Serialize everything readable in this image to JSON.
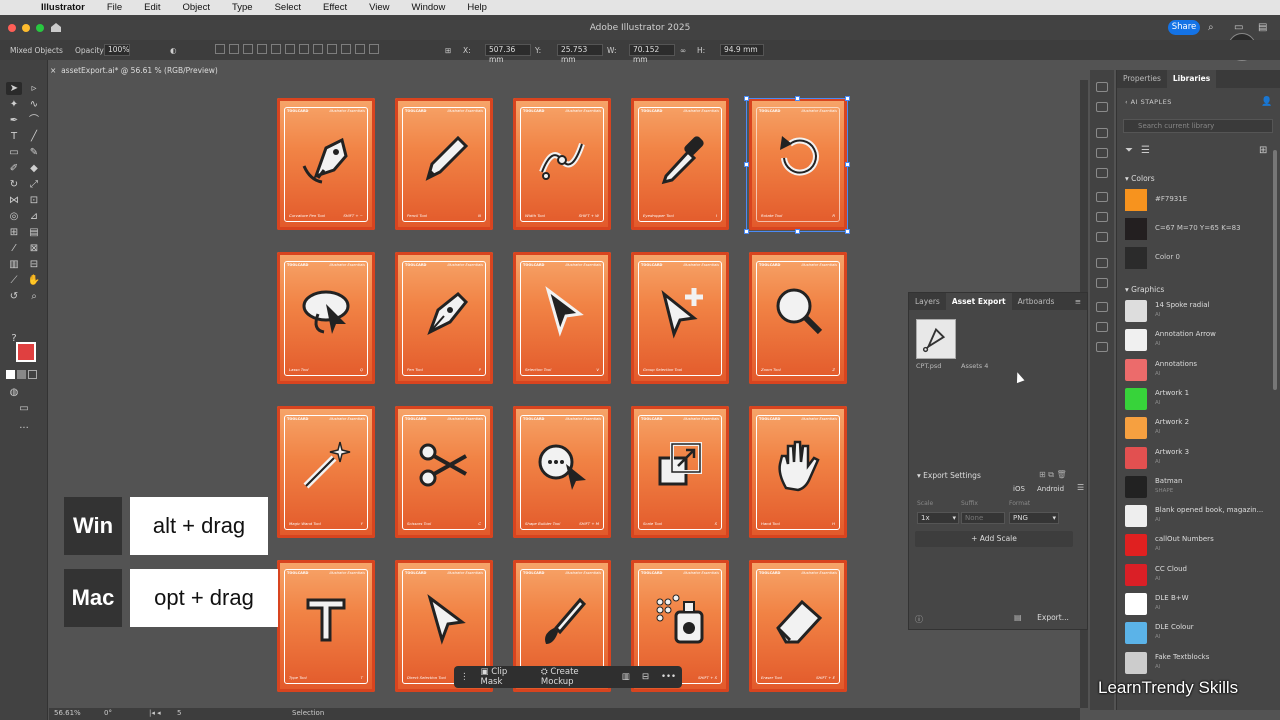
{
  "menubar": {
    "app": "Illustrator",
    "items": [
      "File",
      "Edit",
      "Object",
      "Type",
      "Select",
      "Effect",
      "View",
      "Window",
      "Help"
    ]
  },
  "titlebar": {
    "title": "Adobe Illustrator 2025",
    "share": "Share",
    "logo": "TS"
  },
  "controlbar": {
    "selection": "Mixed Objects",
    "opacity_label": "Opacity:",
    "opacity": "100%",
    "x_label": "X:",
    "x": "507.36 mm",
    "y_label": "Y:",
    "y": "25.753 mm",
    "w_label": "W:",
    "w": "70.152 mm",
    "h_label": "H:",
    "h": "94.9 mm"
  },
  "document_tab": "assetExport.ai* @ 56.61 % (RGB/Preview)",
  "cards": [
    {
      "name": "Curvature Pen Tool",
      "shortcut": "SHIFT + ~",
      "icon": "curvature-pen"
    },
    {
      "name": "Pencil Tool",
      "shortcut": "N",
      "icon": "pencil"
    },
    {
      "name": "Width Tool",
      "shortcut": "SHIFT + W",
      "icon": "width"
    },
    {
      "name": "Eyedropper Tool",
      "shortcut": "I",
      "icon": "eyedropper"
    },
    {
      "name": "Rotate Tool",
      "shortcut": "R",
      "icon": "rotate"
    },
    {
      "name": "Lasso Tool",
      "shortcut": "Q",
      "icon": "lasso"
    },
    {
      "name": "Pen Tool",
      "shortcut": "P",
      "icon": "pen"
    },
    {
      "name": "Selection Tool",
      "shortcut": "V",
      "icon": "selection"
    },
    {
      "name": "Group Selection Tool",
      "shortcut": "",
      "icon": "group-selection"
    },
    {
      "name": "Zoom Tool",
      "shortcut": "Z",
      "icon": "zoom"
    },
    {
      "name": "Magic Wand Tool",
      "shortcut": "Y",
      "icon": "magic-wand"
    },
    {
      "name": "Scissors Tool",
      "shortcut": "C",
      "icon": "scissors"
    },
    {
      "name": "Shape Builder Tool",
      "shortcut": "SHIFT + M",
      "icon": "shape-builder"
    },
    {
      "name": "Scale Tool",
      "shortcut": "S",
      "icon": "scale"
    },
    {
      "name": "Hand Tool",
      "shortcut": "H",
      "icon": "hand"
    },
    {
      "name": "Type Tool",
      "shortcut": "T",
      "icon": "type"
    },
    {
      "name": "Direct Selection Tool",
      "shortcut": "A",
      "icon": "direct-selection"
    },
    {
      "name": "Paintbrush Tool",
      "shortcut": "B",
      "icon": "paintbrush"
    },
    {
      "name": "Symbol Sprayer Tool",
      "shortcut": "SHIFT + S",
      "icon": "symbol-sprayer"
    },
    {
      "name": "Eraser Tool",
      "shortcut": "SHIFT + E",
      "icon": "eraser"
    }
  ],
  "card_header": {
    "left": "TOOLCARD",
    "right": "Illustrator Essentials"
  },
  "shortcut_overlay": {
    "win_os": "Win",
    "win_keys": "alt + drag",
    "mac_os": "Mac",
    "mac_keys": "opt + drag"
  },
  "context_bar": {
    "clip_mask": "Clip Mask",
    "create_mockup": "Create Mockup"
  },
  "statusbar": {
    "zoom": "56.61%",
    "rotation": "0°",
    "artboard": "5",
    "tool": "Selection"
  },
  "asset_export": {
    "tabs": [
      "Layers",
      "Asset Export",
      "Artboards"
    ],
    "active_tab": "Asset Export",
    "assets": [
      {
        "label": "CPT.psd"
      },
      {
        "label": "Assets 4"
      }
    ],
    "settings_title": "Export Settings",
    "platforms": [
      "iOS",
      "Android"
    ],
    "col_scale": "Scale",
    "col_suffix": "Suffix",
    "col_format": "Format",
    "scale": "1x",
    "suffix_placeholder": "None",
    "format": "PNG",
    "add_scale": "Add Scale",
    "export_button": "Export..."
  },
  "libraries": {
    "tabs": [
      "Properties",
      "Libraries"
    ],
    "active_tab": "Libraries",
    "library_name": "AI STAPLES",
    "search_placeholder": "Search current library",
    "colors_title": "Colors",
    "colors": [
      {
        "name": "#F7931E",
        "hex": "#F7931E"
      },
      {
        "name": "C=67 M=70 Y=65 K=83",
        "hex": "#231f20"
      },
      {
        "name": "Color 0",
        "hex": "#2b2b2b"
      }
    ],
    "graphics_title": "Graphics",
    "graphics": [
      {
        "name": "14 Spoke radial",
        "type": "AI",
        "thumb": "#dddddd"
      },
      {
        "name": "Annotation Arrow",
        "type": "AI",
        "thumb": "#f0f0f0"
      },
      {
        "name": "Annotations",
        "type": "AI",
        "thumb": "#ec6b6b"
      },
      {
        "name": "Artwork 1",
        "type": "AI",
        "thumb": "#37d33a"
      },
      {
        "name": "Artwork 2",
        "type": "AI",
        "thumb": "#f6a040"
      },
      {
        "name": "Artwork 3",
        "type": "AI",
        "thumb": "#e25050"
      },
      {
        "name": "Batman",
        "type": "SHAPE",
        "thumb": "#222222"
      },
      {
        "name": "Blank opened book, magazin...",
        "type": "AI",
        "thumb": "#eeeeee"
      },
      {
        "name": "callOut Numbers",
        "type": "AI",
        "thumb": "#e02020"
      },
      {
        "name": "CC Cloud",
        "type": "AI",
        "thumb": "#da1f26"
      },
      {
        "name": "DLE B+W",
        "type": "AI",
        "thumb": "#ffffff"
      },
      {
        "name": "DLE Colour",
        "type": "AI",
        "thumb": "#5bb3e8"
      },
      {
        "name": "Fake Textblocks",
        "type": "AI",
        "thumb": "#cccccc"
      }
    ]
  },
  "watermark": "LearnTrendy Skills",
  "colors": {
    "accent": "#1473e6",
    "card_orange": "#F18345",
    "selection": "#4a8af5"
  }
}
